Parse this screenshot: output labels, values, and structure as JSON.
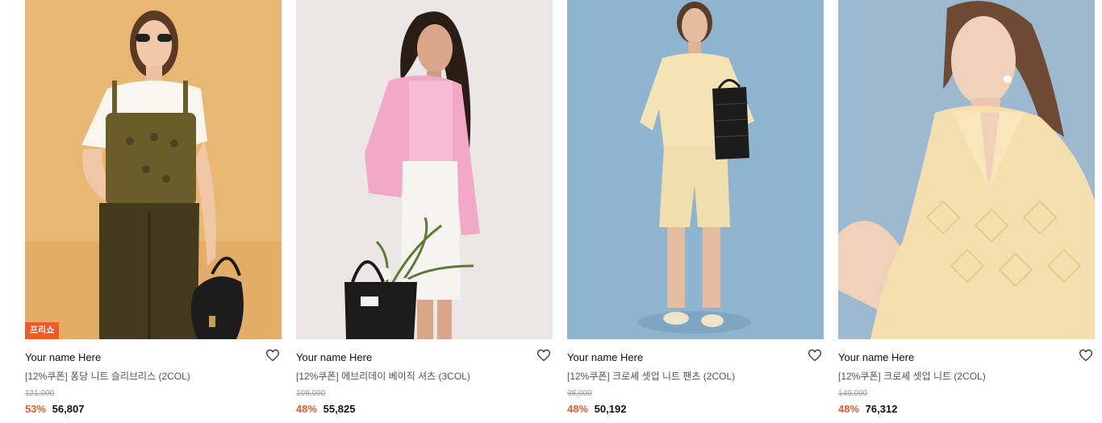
{
  "colors": {
    "accent": "#f05a28",
    "heart": "#333333"
  },
  "icons": {
    "wishlist": "heart-outline-icon"
  },
  "products": [
    {
      "badge": "프리쇼",
      "brand": "Your name Here",
      "title": "[12%쿠폰] 퐁당 니트 슬리브리스 (2COL)",
      "original_price": "121,000",
      "discount": "53%",
      "price": "56,807"
    },
    {
      "brand": "Your name Here",
      "title": "[12%쿠폰] 에브리데이 베이직 셔츠 (3COL)",
      "original_price": "109,000",
      "discount": "48%",
      "price": "55,825"
    },
    {
      "brand": "Your name Here",
      "title": "[12%쿠폰] 크로셰 셋업 니트 팬츠 (2COL)",
      "original_price": "98,000",
      "discount": "48%",
      "price": "50,192"
    },
    {
      "brand": "Your name Here",
      "title": "[12%쿠폰] 크로셰 셋업 니트 (2COL)",
      "original_price": "149,000",
      "discount": "48%",
      "price": "76,312"
    }
  ]
}
